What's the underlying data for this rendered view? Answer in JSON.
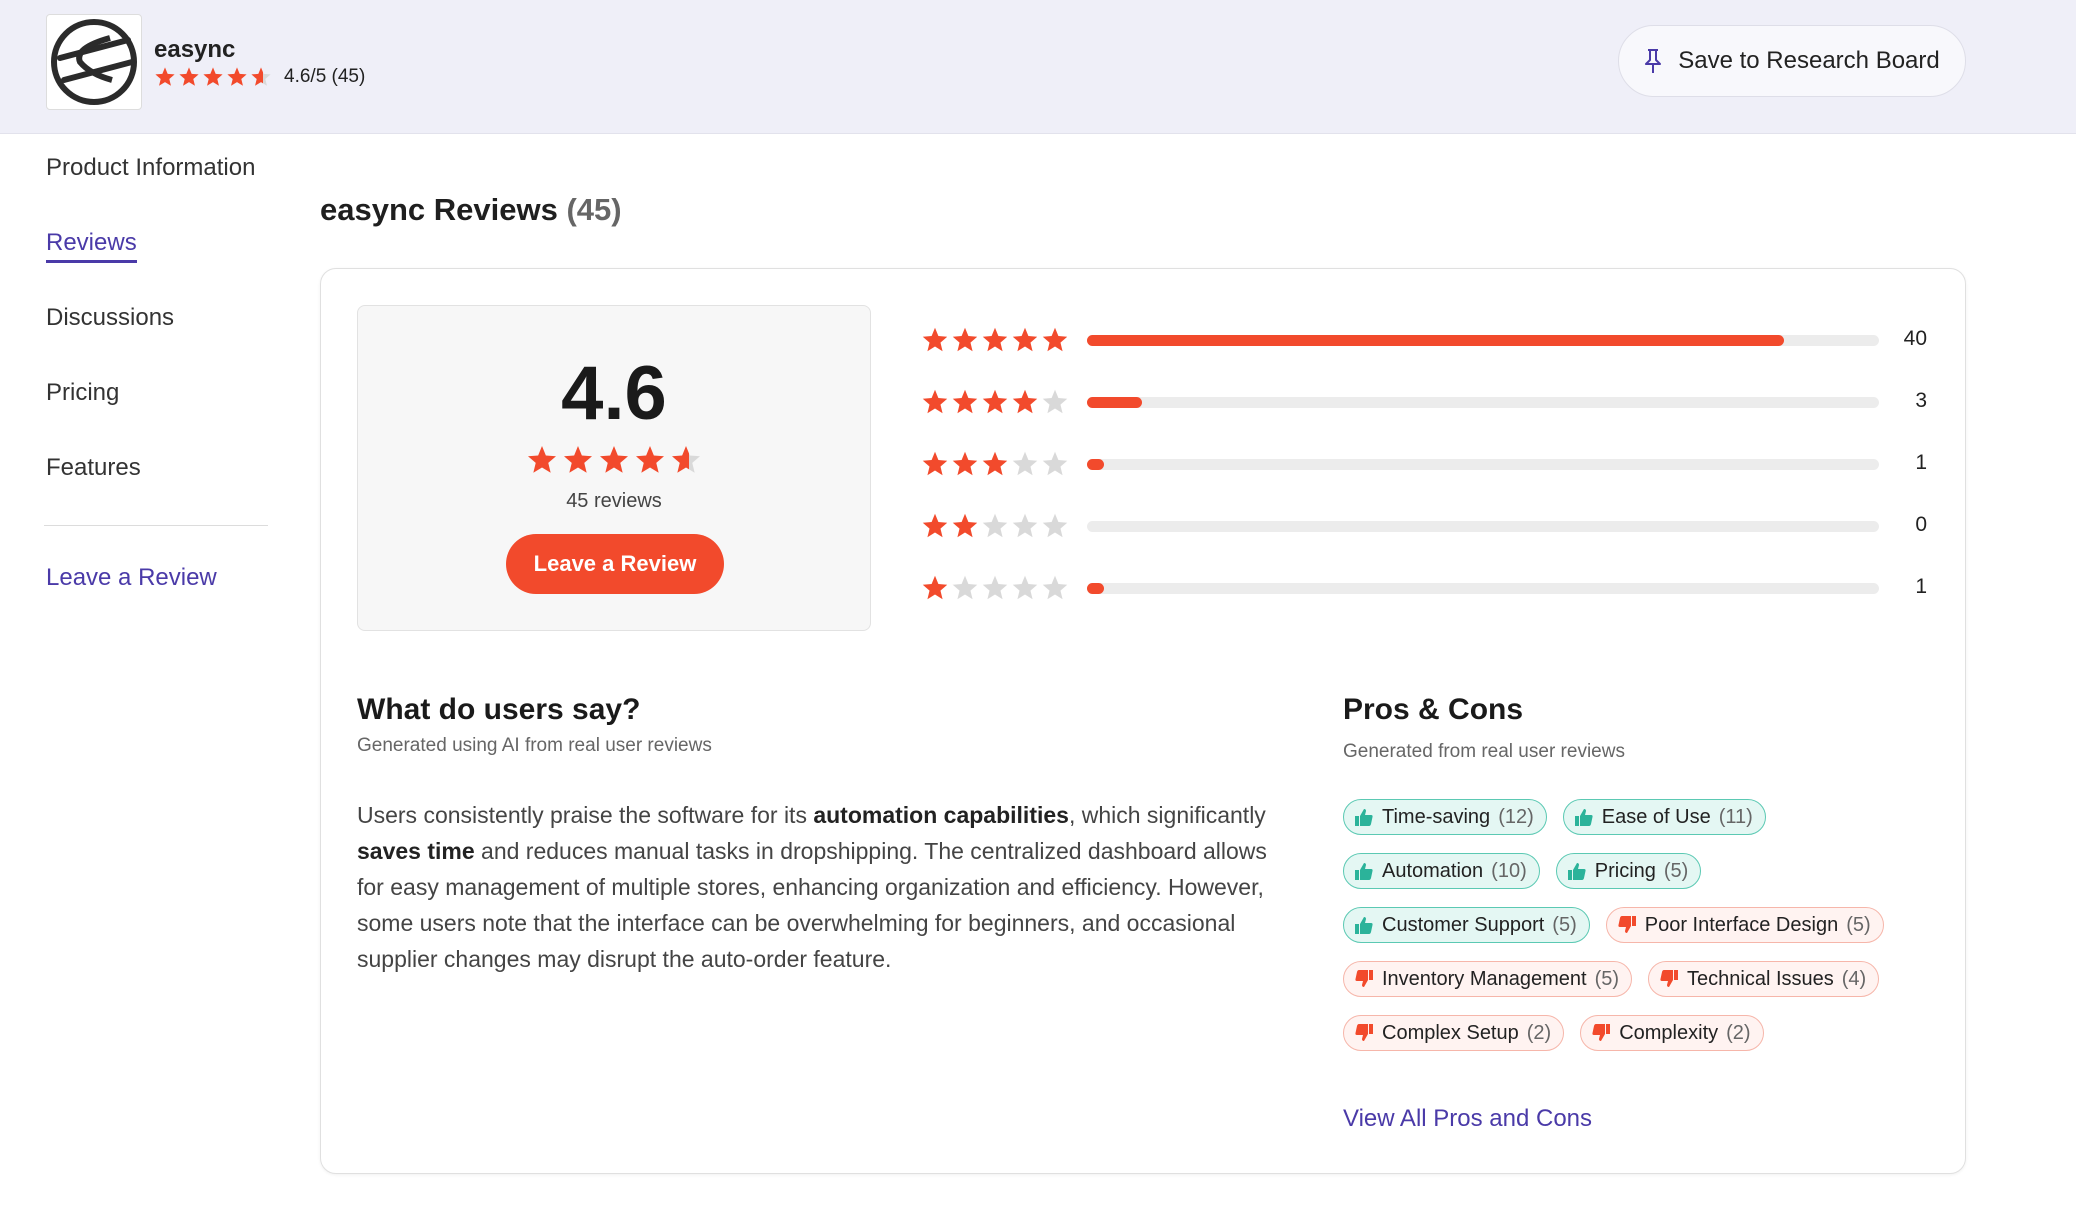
{
  "header": {
    "product_name": "easync",
    "rating_text": "4.6/5 (45)",
    "rating_value": 4.6,
    "save_label": "Save to Research Board"
  },
  "sidebar": {
    "items": [
      {
        "label": "Product Information"
      },
      {
        "label": "Reviews"
      },
      {
        "label": "Discussions"
      },
      {
        "label": "Pricing"
      },
      {
        "label": "Features"
      }
    ],
    "active": "Reviews",
    "leave_review": "Leave a Review"
  },
  "reviews": {
    "title": "easync Reviews",
    "count": "(45)",
    "score": "4.6",
    "rating_value": 4.6,
    "review_count_text": "45 reviews",
    "leave_button": "Leave a Review",
    "distribution": [
      {
        "stars": 5,
        "count": "40",
        "fraction": 0.88
      },
      {
        "stars": 4,
        "count": "3",
        "fraction": 0.07
      },
      {
        "stars": 3,
        "count": "1",
        "fraction": 0.022
      },
      {
        "stars": 2,
        "count": "0",
        "fraction": 0
      },
      {
        "stars": 1,
        "count": "1",
        "fraction": 0.022
      }
    ]
  },
  "users_say": {
    "title": "What do users say?",
    "subtitle": "Generated using AI from real user reviews",
    "summary": {
      "p1": "Users consistently praise the software for its ",
      "b1": "automation capabilities",
      "p2": ", which significantly ",
      "b2": "saves time",
      "p3": " and reduces manual tasks in dropshipping. The centralized dashboard allows for easy management of multiple stores, enhancing organization and efficiency. However, some users note that the interface can be overwhelming for beginners, and occasional supplier changes may disrupt the auto-order feature."
    }
  },
  "pros_cons": {
    "title": "Pros & Cons",
    "subtitle": "Generated from real user reviews",
    "tags": [
      {
        "label": "Time-saving",
        "count": "(12)",
        "type": "pro"
      },
      {
        "label": "Ease of Use",
        "count": "(11)",
        "type": "pro"
      },
      {
        "label": "Automation",
        "count": "(10)",
        "type": "pro"
      },
      {
        "label": "Pricing",
        "count": "(5)",
        "type": "pro"
      },
      {
        "label": "Customer Support",
        "count": "(5)",
        "type": "pro"
      },
      {
        "label": "Poor Interface Design",
        "count": "(5)",
        "type": "con"
      },
      {
        "label": "Inventory Management",
        "count": "(5)",
        "type": "con"
      },
      {
        "label": "Technical Issues",
        "count": "(4)",
        "type": "con"
      },
      {
        "label": "Complex Setup",
        "count": "(2)",
        "type": "con"
      },
      {
        "label": "Complexity",
        "count": "(2)",
        "type": "con"
      }
    ],
    "view_all": "View All Pros and Cons"
  },
  "colors": {
    "star": "#f24a2c",
    "star_empty": "#d9d9d9",
    "accent": "#4a3aa8",
    "pro": "#2bb39a",
    "con": "#f24a2c"
  }
}
